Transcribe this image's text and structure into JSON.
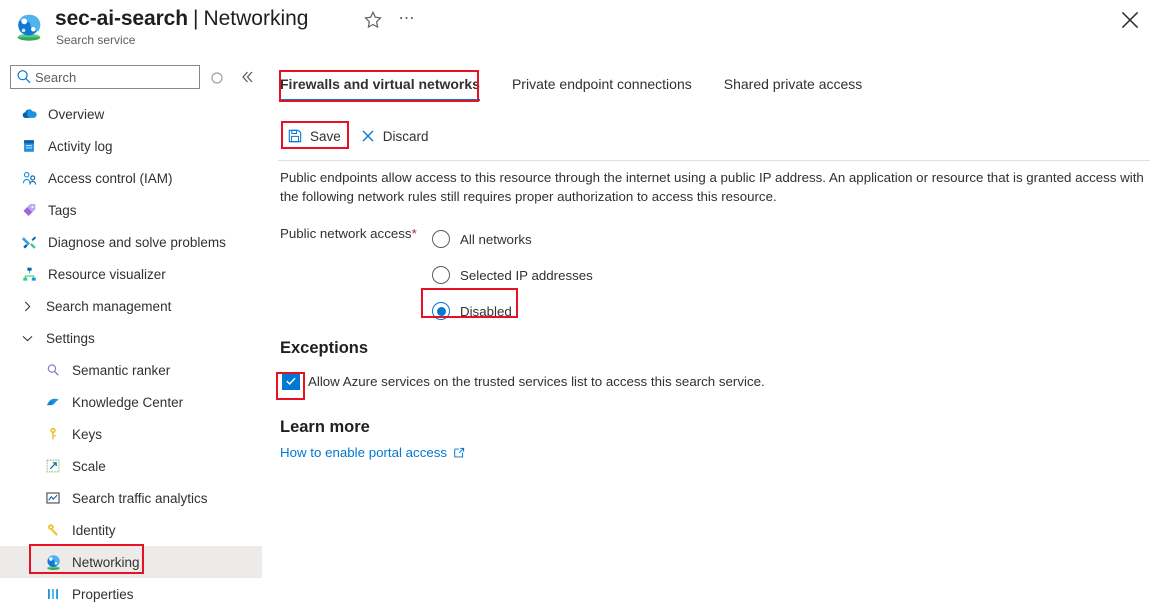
{
  "titlebar": {
    "resource_name": "sec-ai-search",
    "separator": "|",
    "page_name": "Networking",
    "subtitle": "Search service",
    "favorite_icon": "star-icon",
    "more_icon": "ellipsis-icon",
    "close_icon": "close-icon",
    "resource_icon": "azure-ai-search-icon"
  },
  "sidebar": {
    "search": {
      "placeholder": "Search",
      "icon": "search-icon"
    },
    "refresh_icon": "refresh-icon",
    "collapse_icon": "double-chevron-left-icon",
    "items": [
      {
        "label": "Overview",
        "icon": "cloud-icon",
        "level": "top",
        "selected": false
      },
      {
        "label": "Activity log",
        "icon": "activity-log-icon",
        "level": "top",
        "selected": false
      },
      {
        "label": "Access control (IAM)",
        "icon": "people-icon",
        "level": "top",
        "selected": false
      },
      {
        "label": "Tags",
        "icon": "tag-icon",
        "level": "top",
        "selected": false
      },
      {
        "label": "Diagnose and solve problems",
        "icon": "wrench-icon",
        "level": "top",
        "selected": false
      },
      {
        "label": "Resource visualizer",
        "icon": "resource-visualizer-icon",
        "level": "top",
        "selected": false
      },
      {
        "label": "Search management",
        "icon": "chevron-right-icon",
        "level": "group",
        "selected": false
      },
      {
        "label": "Settings",
        "icon": "chevron-down-icon",
        "level": "group",
        "selected": false
      },
      {
        "label": "Semantic ranker",
        "icon": "magnifier-icon",
        "level": "child",
        "selected": false
      },
      {
        "label": "Knowledge Center",
        "icon": "knowledge-center-icon",
        "level": "child",
        "selected": false
      },
      {
        "label": "Keys",
        "icon": "key-icon",
        "level": "child",
        "selected": false
      },
      {
        "label": "Scale",
        "icon": "scale-icon",
        "level": "child",
        "selected": false
      },
      {
        "label": "Search traffic analytics",
        "icon": "analytics-icon",
        "level": "child",
        "selected": false
      },
      {
        "label": "Identity",
        "icon": "identity-key-icon",
        "level": "child",
        "selected": false
      },
      {
        "label": "Networking",
        "icon": "networking-icon",
        "level": "child",
        "selected": true
      },
      {
        "label": "Properties",
        "icon": "properties-icon",
        "level": "child",
        "selected": false
      }
    ]
  },
  "content": {
    "tabs": [
      {
        "label": "Firewalls and virtual networks",
        "active": true
      },
      {
        "label": "Private endpoint connections",
        "active": false
      },
      {
        "label": "Shared private access",
        "active": false
      }
    ],
    "toolbar": {
      "save_label": "Save",
      "save_icon": "save-disk-icon",
      "discard_label": "Discard",
      "discard_icon": "discard-x-icon"
    },
    "description": "Public endpoints allow access to this resource through the internet using a public IP address. An application or resource that is granted access with the following network rules still requires proper authorization to access this resource.",
    "public_network_access": {
      "label": "Public network access",
      "required_marker": "*",
      "options": [
        {
          "label": "All networks",
          "selected": false
        },
        {
          "label": "Selected IP addresses",
          "selected": false
        },
        {
          "label": "Disabled",
          "selected": true
        }
      ]
    },
    "exceptions": {
      "heading": "Exceptions",
      "checkbox_label": "Allow Azure services on the trusted services list to access this search service.",
      "checkbox_checked": true,
      "check_icon": "check-icon"
    },
    "learn_more": {
      "heading": "Learn more",
      "link_label": "How to enable portal access",
      "link_icon": "external-link-icon"
    }
  },
  "annotations": {
    "color": "#e81123",
    "boxes": [
      "firewalls-and-virtual-networks-tab",
      "save-button",
      "disabled-radio",
      "trusted-services-checkbox",
      "networking-sidebar-item"
    ]
  },
  "colors": {
    "accent": "#0078d4",
    "selected_row": "#edebe9",
    "required_asterisk": "#a4262c",
    "annotation_red": "#e81123"
  }
}
